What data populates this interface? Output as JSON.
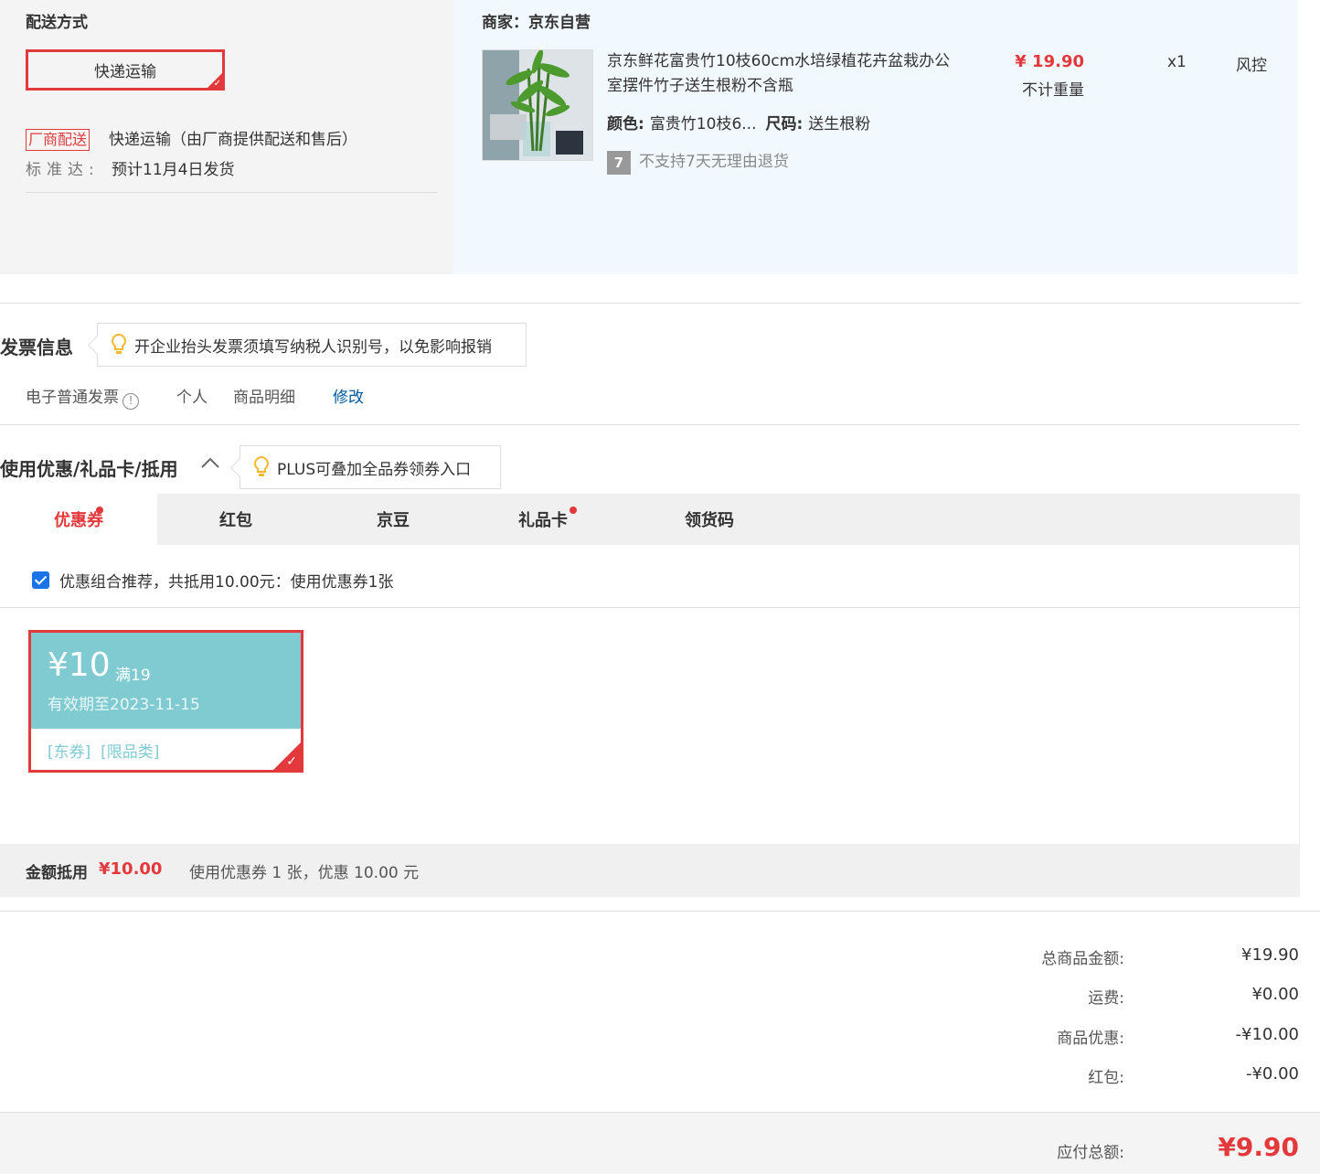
{
  "shipping": {
    "title": "配送方式",
    "method_button": "快递运输",
    "vendor_tag": "厂商配送",
    "vendor_desc": "快递运输（由厂商提供配送和售后）",
    "standard_label": "标准达:",
    "standard_value": "预计11月4日发货"
  },
  "seller": {
    "title": "商家：京东自营",
    "product": {
      "name": "京东鲜花富贵竹10枝60cm水培绿植花卉盆栽办公室摆件竹子送生根粉不含瓶",
      "price": "¥ 19.90",
      "weight": "不计重量",
      "qty": "x1",
      "status": "风控",
      "color_label": "颜色:",
      "color_value": "富贵竹10枝6...",
      "size_label": "尺码:",
      "size_value": "送生根粉",
      "return_icon": "7",
      "return_text": "不支持7天无理由退货"
    }
  },
  "invoice": {
    "title": "发票信息",
    "tip": "开企业抬头发票须填写纳税人识别号，以免影响报销",
    "type": "电子普通发票",
    "info_icon": "!",
    "holder": "个人",
    "content": "商品明细",
    "edit": "修改"
  },
  "discount": {
    "title": "使用优惠/礼品卡/抵用",
    "tip": "PLUS可叠加全品券领券入口",
    "tabs": [
      {
        "label": "优惠券",
        "active": true,
        "dot": true
      },
      {
        "label": "红包",
        "active": false,
        "dot": false
      },
      {
        "label": "京豆",
        "active": false,
        "dot": false
      },
      {
        "label": "礼品卡",
        "active": false,
        "dot": true
      },
      {
        "label": "领货码",
        "active": false,
        "dot": false
      }
    ],
    "recommend_text": "优惠组合推荐，共抵用10.00元：使用优惠券1张",
    "recommend_checked": true,
    "coupon": {
      "amount": "¥10",
      "condition": "满19",
      "validity": "有效期至2023-11-15",
      "tags": "[东券]  [限品类]"
    },
    "deduct_label": "金额抵用",
    "deduct_amount": "¥10.00",
    "deduct_desc": "使用优惠券 1 张，优惠 10.00 元"
  },
  "summary": {
    "rows": [
      {
        "label": "总商品金额:",
        "value": "¥19.90"
      },
      {
        "label": "运费:",
        "value": "¥0.00"
      },
      {
        "label": "商品优惠:",
        "value": "-¥10.00"
      },
      {
        "label": "红包:",
        "value": "-¥0.00"
      }
    ],
    "total_label": "应付总额:",
    "total_value": "¥9.90"
  },
  "colors": {
    "accent": "#e4393c",
    "coupon": "#7fcbd1",
    "link": "#005aa0"
  }
}
